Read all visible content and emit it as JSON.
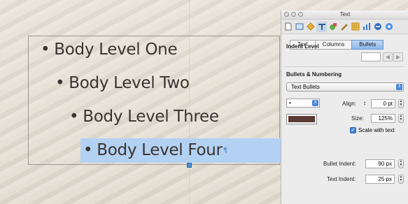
{
  "slide": {
    "bullets": [
      {
        "marker": "•",
        "text": "Body Level One"
      },
      {
        "marker": "•",
        "text": "Body Level Two"
      },
      {
        "marker": "•",
        "text": "Body Level Three"
      },
      {
        "marker": "•",
        "text": "Body Level Four"
      }
    ],
    "text_color": "#3b3330",
    "selection_color": "#b3d1f3"
  },
  "inspector": {
    "title": "Text",
    "toolbar_icons": [
      "document-icon",
      "slide-icon",
      "build-icon",
      "text-icon",
      "graphic-icon",
      "metrics-icon",
      "table-icon",
      "chart-icon",
      "hyperlink-icon",
      "quicktime-icon"
    ],
    "tabs": [
      "Text",
      "Columns",
      "Bullets"
    ],
    "active_tab": "Bullets",
    "indent_level_label": "Indent Level",
    "bullets_numbering_label": "Bullets & Numbering",
    "bullet_type": "Text Bullets",
    "bullet_char": "•",
    "bullet_color": "#5a3a33",
    "align_label": "Align:",
    "align_value": "0 pt",
    "size_label": "Size:",
    "size_value": "125%",
    "scale_with_text_label": "Scale with text",
    "bullet_indent_label": "Bullet Indent:",
    "bullet_indent_value": "90 px",
    "text_indent_label": "Text Indent:",
    "text_indent_value": "25 px"
  }
}
